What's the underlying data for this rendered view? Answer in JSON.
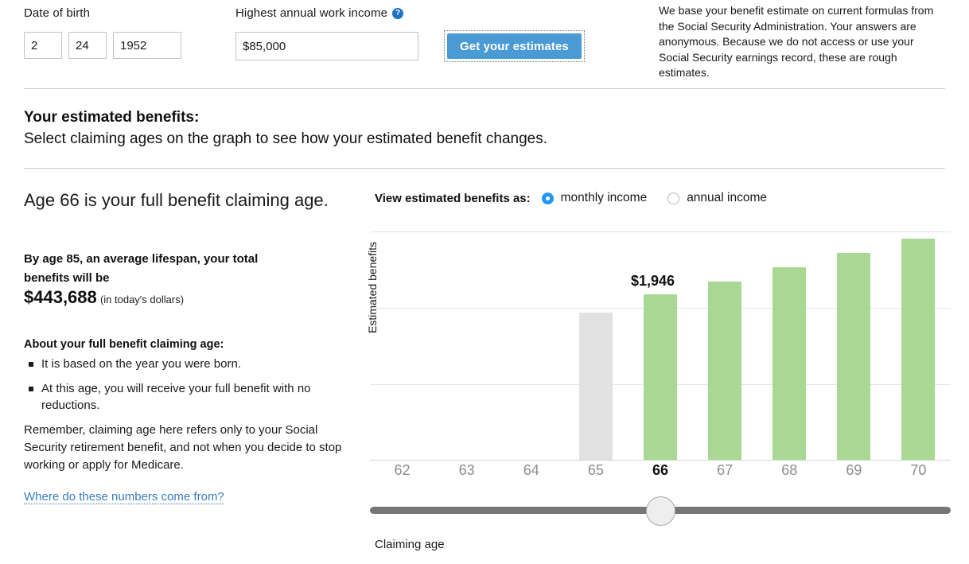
{
  "form": {
    "dob_label": "Date of birth",
    "dob_month": "2",
    "dob_day": "24",
    "dob_year": "1952",
    "dob_month_placeholder": "MM",
    "dob_day_placeholder": "DD",
    "dob_year_placeholder": "YYYY",
    "income_label": "Highest annual work income",
    "income_help_icon": "question-mark-icon",
    "income_help_glyph": "?",
    "income_value": "$85,000",
    "income_placeholder": "$0",
    "submit_label": "Get your estimates",
    "disclaimer": "We base your benefit estimate on current formulas from the Social Security Administration. Your answers are anonymous. Because we do not access or use your Social Security earnings record, these are rough estimates."
  },
  "section": {
    "heading": "Your estimated benefits:",
    "subheading": "Select claiming ages on the graph to see how your estimated benefit changes."
  },
  "left": {
    "title": "Age 66 is your full benefit claiming age.",
    "total_line1": "By age 85, an average lifespan, your total",
    "total_line2": "benefits will be",
    "total_amount": "$443,688",
    "total_note": "(in today's dollars)",
    "about_heading": "About your full benefit claiming age:",
    "bullets": [
      "It is based on the year you were born.",
      "At this age, you will receive your full benefit with no reductions."
    ],
    "remember": "Remember, claiming age here refers only to your Social Security retirement benefit, and not when you decide to stop working or apply for Medicare.",
    "link": "Where do these numbers come from?"
  },
  "chart_controls": {
    "view_as_label": "View estimated benefits as:",
    "options": [
      {
        "label": "monthly income",
        "selected": true
      },
      {
        "label": "annual income",
        "selected": false
      }
    ]
  },
  "slider": {
    "name": "claiming-age-slider",
    "min": "62",
    "max": "70",
    "value": "66"
  },
  "chart_data": {
    "type": "bar",
    "title": "",
    "xlabel": "Claiming age",
    "ylabel": "Estimated benefits",
    "categories": [
      "62",
      "63",
      "64",
      "65",
      "66",
      "67",
      "68",
      "69",
      "70"
    ],
    "values": [
      0,
      0,
      0,
      1736,
      1946,
      2101,
      2268,
      2435,
      2603
    ],
    "bar_colors": [
      "#a9d894",
      "#a9d894",
      "#a9d894",
      "#e1e1e1",
      "#a9d894",
      "#a9d894",
      "#a9d894",
      "#a9d894",
      "#a9d894"
    ],
    "selected_category": "66",
    "selected_value_label": "$1,946",
    "ylim": [
      0,
      2700
    ],
    "grid": true,
    "gridlines": [
      900,
      1800,
      2700
    ],
    "legend": "none",
    "accent_color": "#a9d894",
    "muted_color": "#e1e1e1",
    "tick_color": "#8d8d8d",
    "active_tick_color": "#111111"
  }
}
